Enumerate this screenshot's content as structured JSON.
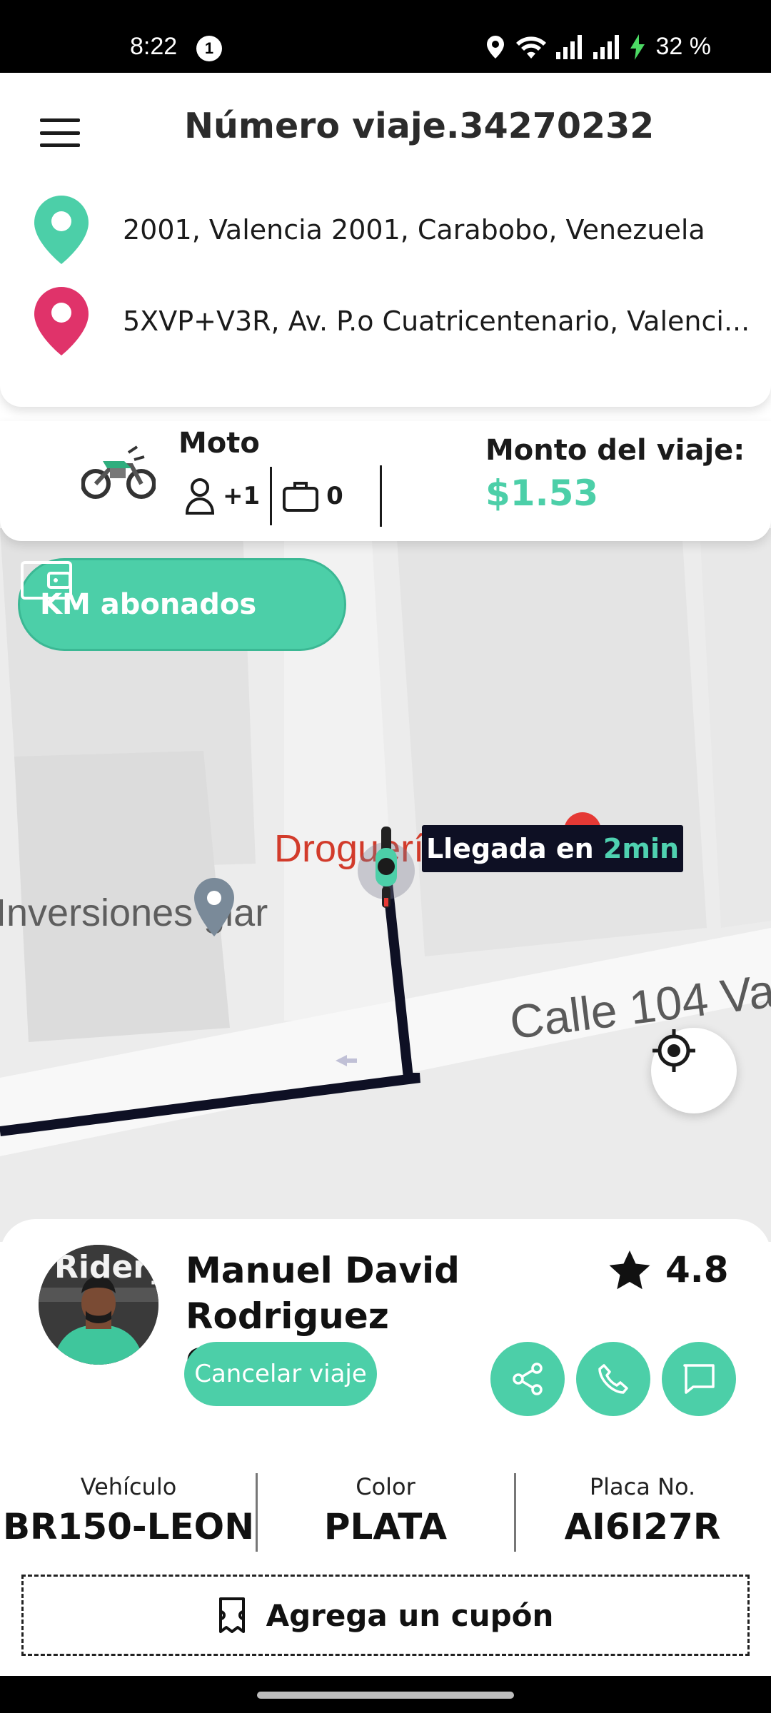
{
  "status_bar": {
    "time": "8:22",
    "notification_count": "1",
    "battery": "32 %"
  },
  "header": {
    "title": "Número viaje.34270232",
    "origin": "2001, Valencia 2001, Carabobo, Venezuela",
    "destination": "5XVP+V3R, Av. P.o Cuatricentenario, Valenci..."
  },
  "trip_info": {
    "vehicle_type": "Moto",
    "passengers": "+1",
    "luggage": "0",
    "fare_label": "Monto del viaje:",
    "fare_value": "$1.53"
  },
  "map": {
    "km_button_label": "KM abonados",
    "poi_drogueria": "Droguería",
    "poi_inversiones": "Inversiones glar",
    "street_label": "Calle 104 Va",
    "eta_prefix": "Llegada en ",
    "eta_value": "2min"
  },
  "driver": {
    "avatar_brand": "Ridery",
    "name": "Manuel David Rodriguez Calanche",
    "rating": "4.8",
    "cancel_label": "Cancelar viaje",
    "vehicle_label": "Vehículo",
    "vehicle_value": "BR150-LEON",
    "color_label": "Color",
    "color_value": "PLATA",
    "plate_label": "Placa No.",
    "plate_value": "AI6I27R",
    "coupon_label": "Agrega un cupón"
  },
  "colors": {
    "accent": "#4ccfa8",
    "destination_pin": "#e0336a",
    "tooltip_bg": "#0e1024"
  }
}
